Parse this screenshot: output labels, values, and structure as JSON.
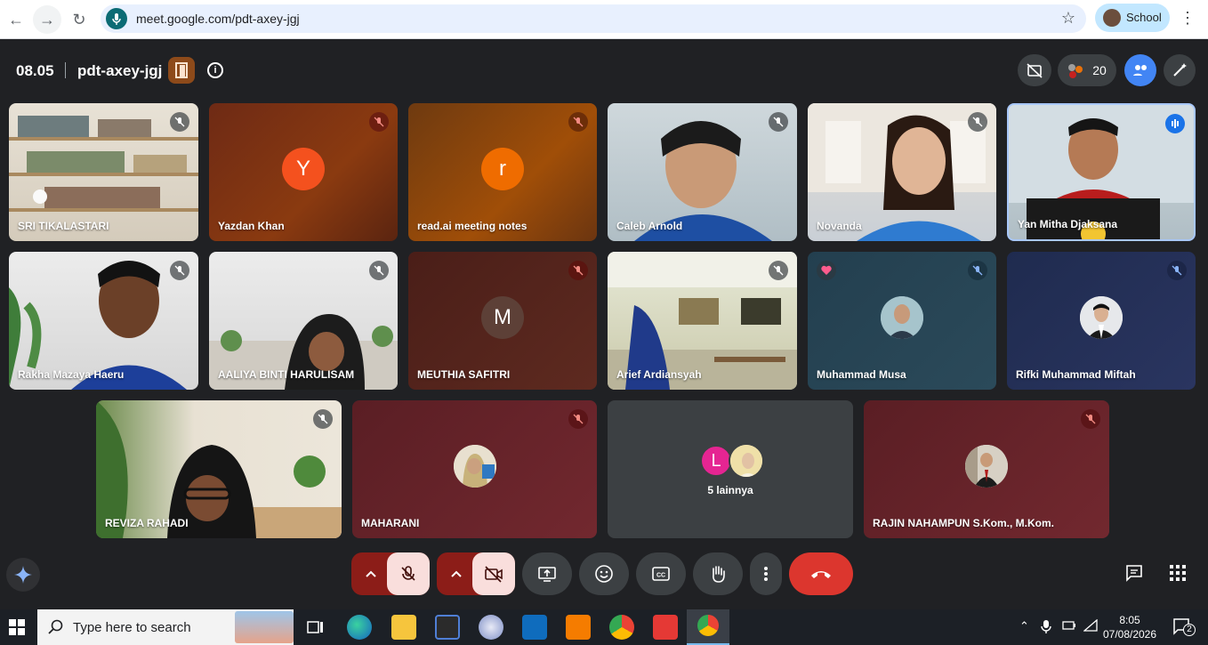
{
  "browser": {
    "url": "meet.google.com/pdt-axey-jgj",
    "profile_label": "School"
  },
  "meeting": {
    "time": "08.05",
    "code": "pdt-axey-jgj",
    "participant_count": "20"
  },
  "tiles": [
    {
      "name": "SRI TIKALASTARI",
      "kind": "video",
      "muted": true
    },
    {
      "name": "Yazdan Khan",
      "kind": "avatar",
      "initial": "Y",
      "avatar_color": "#f4511e",
      "muted": true
    },
    {
      "name": "read.ai meeting notes",
      "kind": "avatar",
      "initial": "r",
      "avatar_color": "#ef6c00",
      "muted": true
    },
    {
      "name": "Caleb Arnold",
      "kind": "video",
      "muted": true
    },
    {
      "name": "Novanda",
      "kind": "video",
      "muted": true
    },
    {
      "name": "Yan Mitha Djaksana",
      "kind": "video",
      "speaking": true
    },
    {
      "name": "Rakha Mazaya Haeru",
      "kind": "video",
      "muted": true
    },
    {
      "name": "AALIYA BINTI HARULISAM",
      "kind": "video",
      "muted": true
    },
    {
      "name": "MEUTHIA SAFITRI",
      "kind": "avatar",
      "initial": "M",
      "avatar_color": "#5d4037",
      "muted": true
    },
    {
      "name": "Arief Ardiansyah",
      "kind": "video",
      "muted": true
    },
    {
      "name": "Muhammad Musa",
      "kind": "photo-avatar",
      "muted": true,
      "reaction": "heart"
    },
    {
      "name": "Rifki Muhammad Miftah",
      "kind": "photo-avatar",
      "muted": true
    },
    {
      "name": "REVIZA RAHADI",
      "kind": "video",
      "muted": true
    },
    {
      "name": "MAHARANI",
      "kind": "photo-avatar",
      "muted": true
    },
    {
      "name": "5 lainnya",
      "kind": "others",
      "initial": "L",
      "avatar_color": "#e52592"
    },
    {
      "name": "RAJIN NAHAMPUN S.Kom., M.Kom.",
      "kind": "photo-avatar",
      "muted": true
    }
  ],
  "controls": {
    "mic_state": "muted",
    "camera_state": "off"
  },
  "taskbar": {
    "search_placeholder": "Type here to search",
    "time": "8:05",
    "date": "07/08/2026",
    "notification_count": "2"
  },
  "colors": {
    "meet_bg": "#202124",
    "end_call": "#ea4335",
    "muted_red": "#f9dedc"
  }
}
